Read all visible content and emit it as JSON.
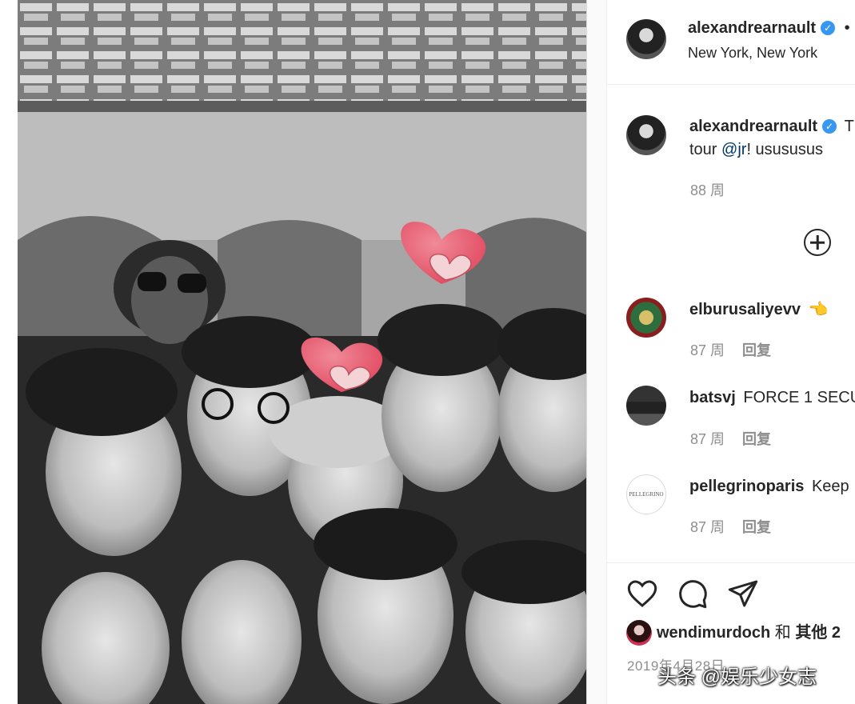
{
  "post": {
    "author": "alexandrearnault",
    "verified_icon": "verified-badge-icon",
    "location": "New York, New York",
    "header_more": "•"
  },
  "caption": {
    "author": "alexandrearnault",
    "text_start": "T",
    "line2_prefix": "tour ",
    "mention": "@jr",
    "line2_suffix": "! usususus",
    "age": "88 周"
  },
  "load_more_icon": "plus-circle-icon",
  "comments": [
    {
      "user": "elburusaliyevv",
      "text": "👈",
      "age": "87 周",
      "reply": "回复"
    },
    {
      "user": "batsvj",
      "text": "FORCE 1 SECU",
      "age": "87 周",
      "reply": "回复"
    },
    {
      "user": "pellegrinoparis",
      "text": "Keep",
      "age": "87 周",
      "reply": "回复"
    }
  ],
  "actions": [
    "heart-icon",
    "comment-icon",
    "share-icon"
  ],
  "likes": {
    "user": "wendimurdoch",
    "joiner": "和",
    "others": "其他 2"
  },
  "date": "2019年4月28日",
  "watermark": "头条 @娱乐少女志",
  "colors": {
    "verified": "#3897f0",
    "link": "#00376b",
    "muted": "#8e8e8e",
    "heart_sticker": "#e8566c"
  }
}
